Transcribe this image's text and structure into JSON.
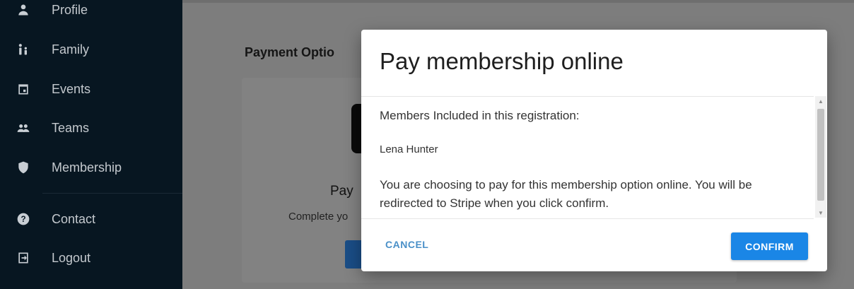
{
  "sidebar": {
    "items": [
      {
        "label": "Profile",
        "icon": "person-icon"
      },
      {
        "label": "Family",
        "icon": "family-icon"
      },
      {
        "label": "Events",
        "icon": "calendar-icon"
      },
      {
        "label": "Teams",
        "icon": "group-icon"
      },
      {
        "label": "Membership",
        "icon": "shield-icon"
      },
      {
        "label": "Contact",
        "icon": "help-icon"
      },
      {
        "label": "Logout",
        "icon": "logout-icon"
      }
    ]
  },
  "main": {
    "payment_options_title": "Payment Optio",
    "card_heading": "Pay",
    "card_subtext": "Complete yo"
  },
  "modal": {
    "title": "Pay membership online",
    "members_label": "Members Included in this registration:",
    "member_name": "Lena Hunter",
    "message": "You are choosing to pay for this membership option online. You will be redirected to Stripe when you click confirm.",
    "cancel_label": "CANCEL",
    "confirm_label": "CONFIRM"
  },
  "colors": {
    "sidebar_bg": "#071621",
    "confirm_bg": "#1a86e6",
    "cancel_text": "#4a90c8"
  }
}
